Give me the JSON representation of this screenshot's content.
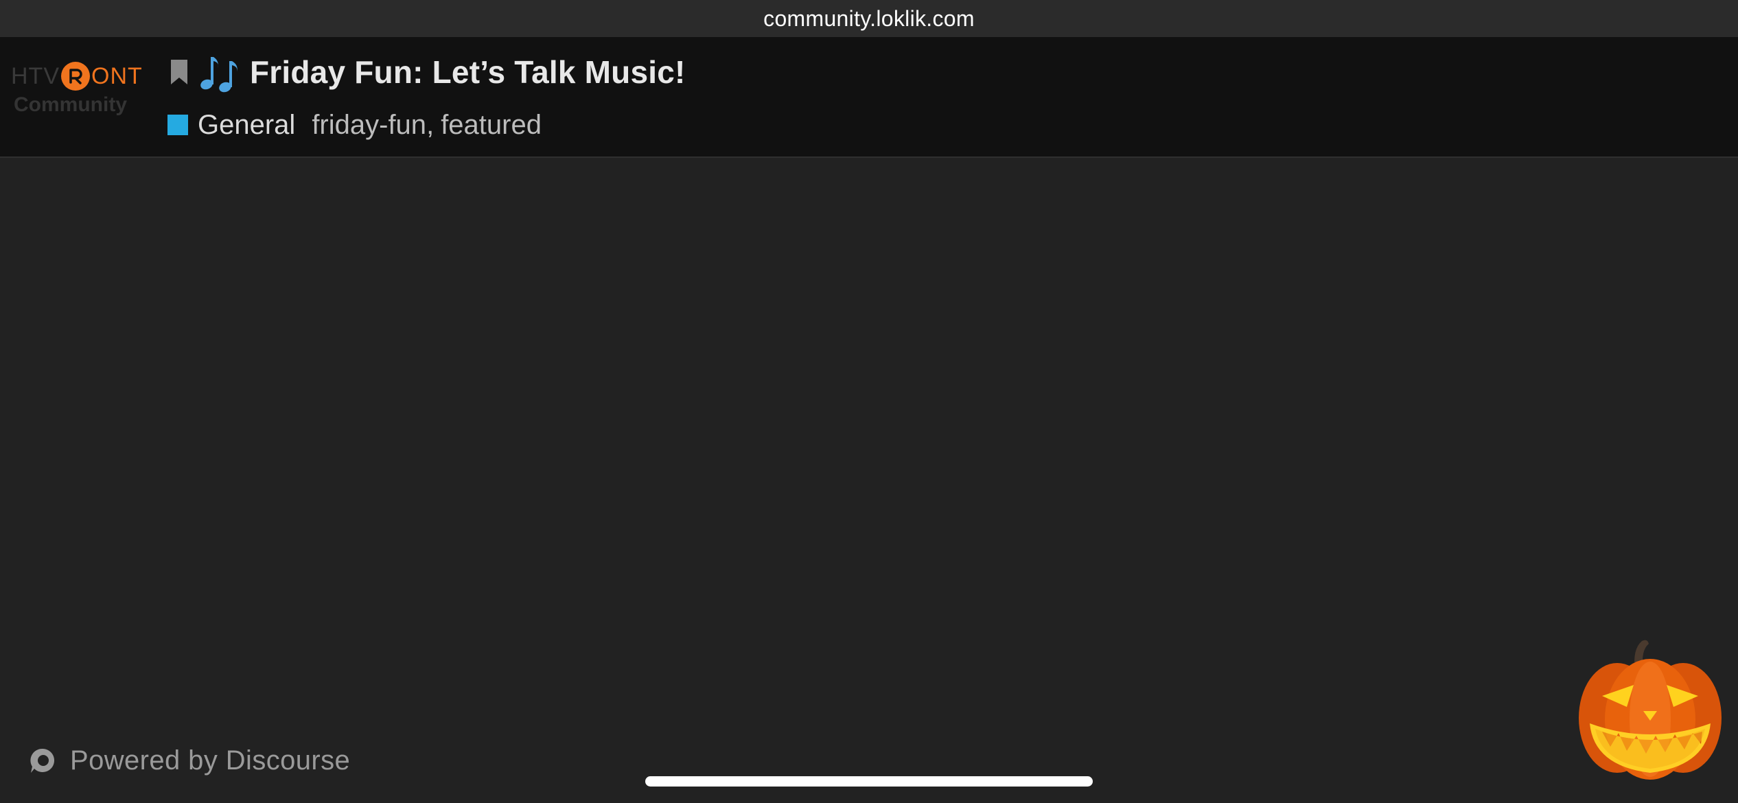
{
  "browser": {
    "url": "community.loklik.com"
  },
  "logo": {
    "text_left": "HTV",
    "text_right": "ONT",
    "subtitle": "Community",
    "accent_color": "#f0741e"
  },
  "topic": {
    "bookmark_icon": "bookmark-icon",
    "emoji_icon": "musical-notes-icon",
    "title": "Friday Fun: Let’s Talk Music!",
    "category": {
      "name": "General",
      "color": "#25aae1"
    },
    "tags": [
      "friday-fun",
      "featured"
    ],
    "tag_separator": ","
  },
  "footer": {
    "icon": "discourse-icon",
    "powered_by": "Powered by Discourse"
  },
  "decoration": {
    "pumpkin_icon": "jack-o-lantern-icon"
  }
}
